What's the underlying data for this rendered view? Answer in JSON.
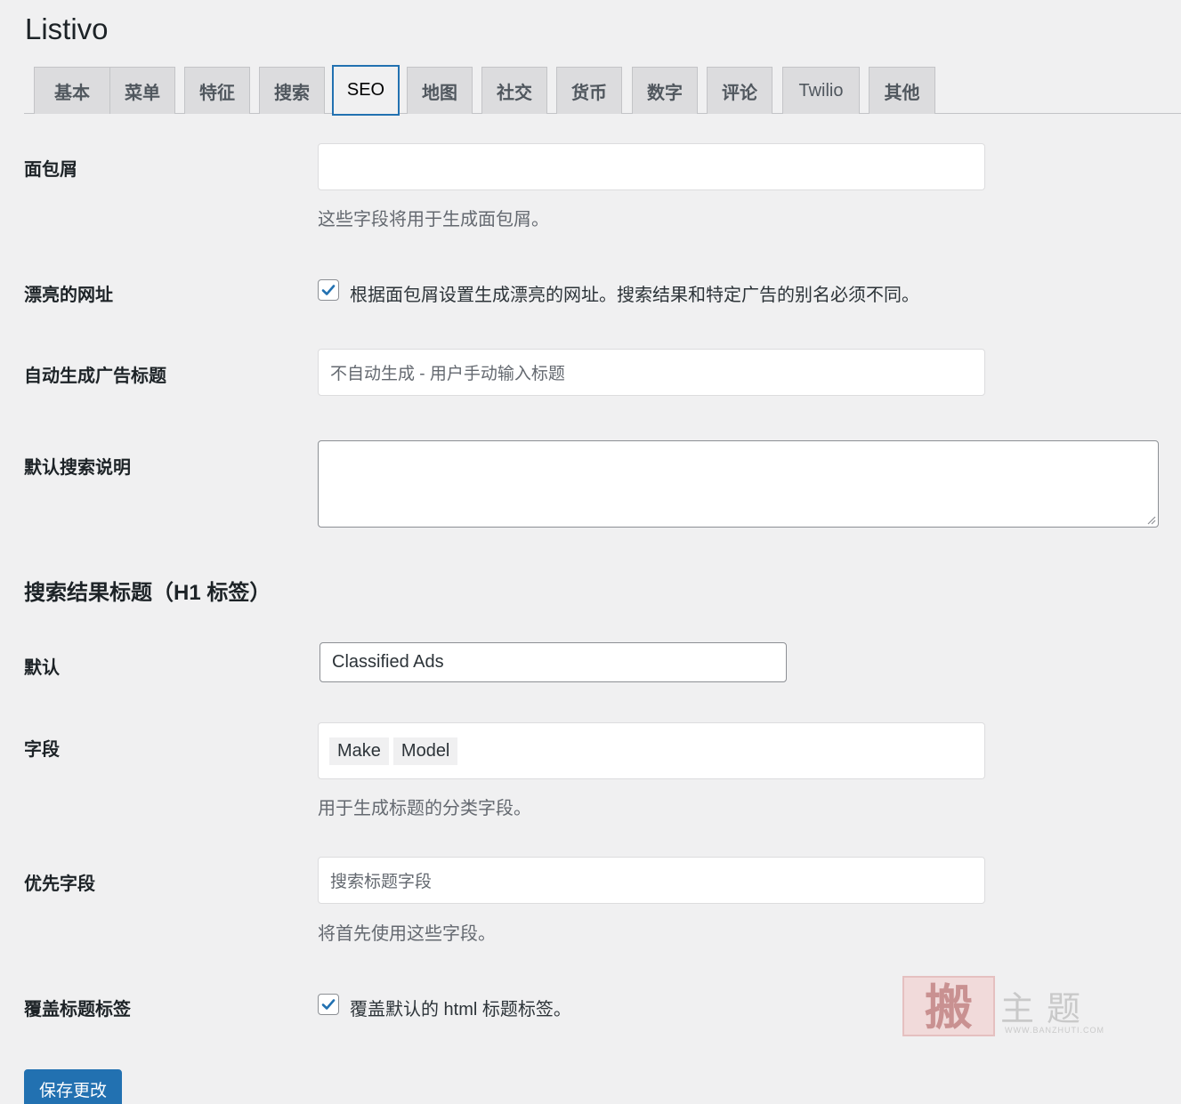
{
  "page_title": "Listivo",
  "tabs": [
    {
      "label": "基本"
    },
    {
      "label": "菜单"
    },
    {
      "label": "特征"
    },
    {
      "label": "搜索"
    },
    {
      "label": "SEO"
    },
    {
      "label": "地图"
    },
    {
      "label": "社交"
    },
    {
      "label": "货币"
    },
    {
      "label": "数字"
    },
    {
      "label": "评论"
    },
    {
      "label": "Twilio"
    },
    {
      "label": "其他"
    }
  ],
  "active_tab": "SEO",
  "breadcrumbs": {
    "label": "面包屑",
    "value": "",
    "help": "这些字段将用于生成面包屑。"
  },
  "pretty_urls": {
    "label": "漂亮的网址",
    "checked": true,
    "description": "根据面包屑设置生成漂亮的网址。搜索结果和特定广告的别名必须不同。"
  },
  "auto_title": {
    "label": "自动生成广告标题",
    "placeholder": "不自动生成 - 用户手动输入标题"
  },
  "default_search_description": {
    "label": "默认搜索说明",
    "value": ""
  },
  "search_results_heading": "搜索结果标题（H1 标签）",
  "default_title": {
    "label": "默认",
    "value": "Classified Ads"
  },
  "fields": {
    "label": "字段",
    "tags": [
      "Make",
      "Model"
    ],
    "help": "用于生成标题的分类字段。"
  },
  "priority_fields": {
    "label": "优先字段",
    "placeholder": "搜索标题字段",
    "help": "将首先使用这些字段。"
  },
  "override_title_tag": {
    "label": "覆盖标题标签",
    "checked": true,
    "description": "覆盖默认的 html 标题标签。"
  },
  "save_button": "保存更改",
  "watermark": {
    "char": "搬",
    "text": "主题",
    "url": "WWW.BANZHUTI.COM"
  },
  "colors": {
    "accent": "#2271b1",
    "background": "#f0f0f1",
    "tab_bg": "#dcdcde"
  }
}
